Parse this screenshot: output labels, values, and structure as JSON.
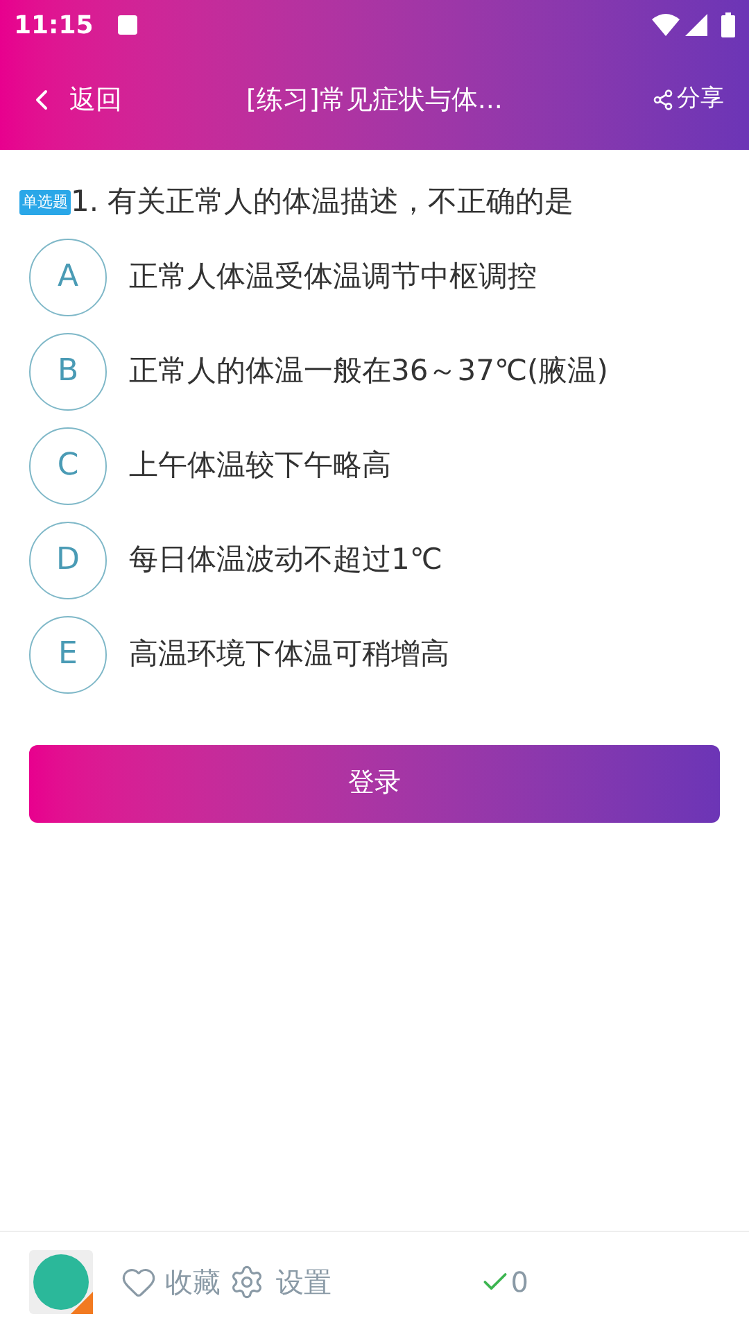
{
  "status_bar": {
    "time": "11:15"
  },
  "header": {
    "back": "返回",
    "title": "[练习]常见症状与体...",
    "share": "分享"
  },
  "question": {
    "type_badge": "单选题",
    "text": "1. 有关正常人的体温描述，不正确的是"
  },
  "options": [
    {
      "letter": "A",
      "text": "正常人体温受体温调节中枢调控"
    },
    {
      "letter": "B",
      "text": "正常人的体温一般在36～37℃(腋温)"
    },
    {
      "letter": "C",
      "text": "上午体温较下午略高"
    },
    {
      "letter": "D",
      "text": "每日体温波动不超过1℃"
    },
    {
      "letter": "E",
      "text": "高温环境下体温可稍增高"
    }
  ],
  "login_button": "登录",
  "bottom_bar": {
    "favorite": "收藏",
    "settings": "设置",
    "correct_count": "0"
  }
}
